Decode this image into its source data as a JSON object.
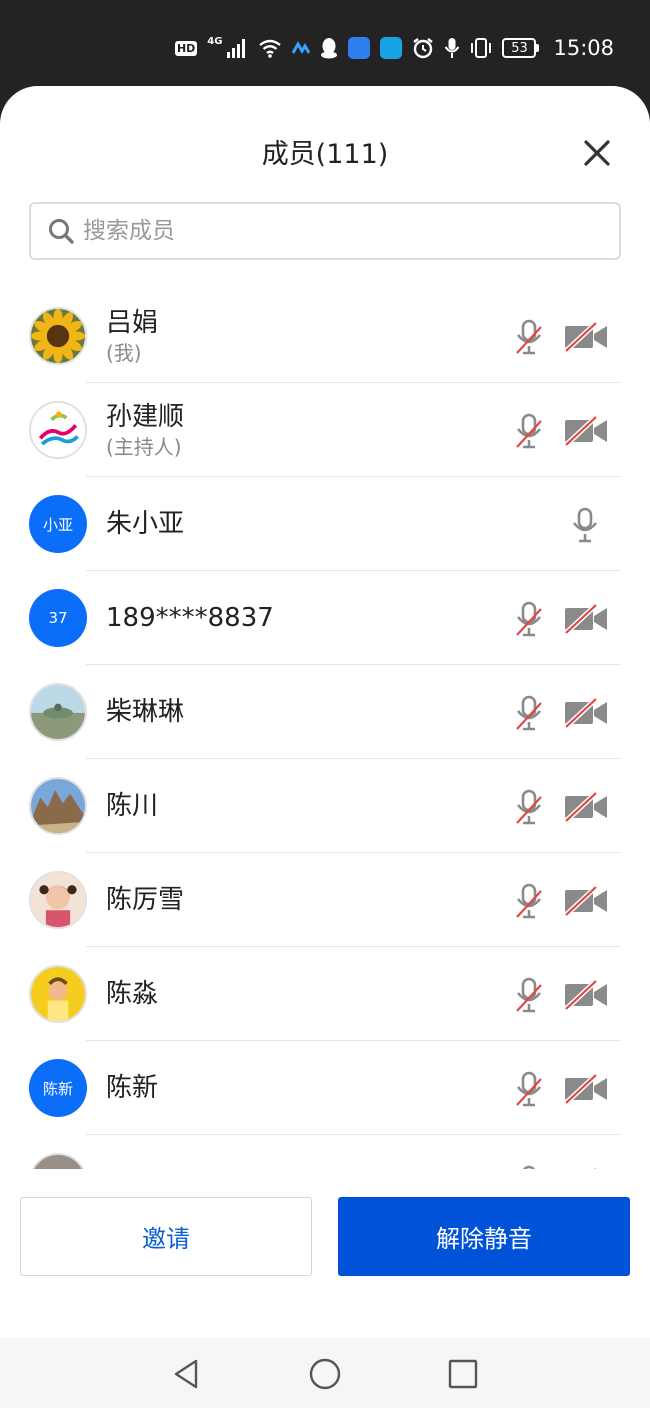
{
  "status_bar": {
    "hd": "HD",
    "network": "4G",
    "battery": "53",
    "time": "15:08"
  },
  "sheet": {
    "title": "成员(111)"
  },
  "search": {
    "placeholder": "搜索成员"
  },
  "members": [
    {
      "name": "吕娟",
      "role": "(我)",
      "avatar_type": "photo",
      "avatar_desc": "sunflower",
      "mic": "muted",
      "camera": "off"
    },
    {
      "name": "孙建顺",
      "role": "(主持人)",
      "avatar_type": "photo",
      "avatar_desc": "colorful-logo",
      "mic": "muted",
      "camera": "off"
    },
    {
      "name": "朱小亚",
      "avatar_type": "text",
      "avatar_text": "小亚",
      "mic": "on",
      "camera": "hidden"
    },
    {
      "name": "189****8837",
      "avatar_type": "text",
      "avatar_text": "37",
      "mic": "muted",
      "camera": "off"
    },
    {
      "name": "柴琳琳",
      "avatar_type": "photo",
      "avatar_desc": "landscape",
      "mic": "muted",
      "camera": "off"
    },
    {
      "name": "陈川",
      "avatar_type": "photo",
      "avatar_desc": "rocks",
      "mic": "muted",
      "camera": "off"
    },
    {
      "name": "陈厉雪",
      "avatar_type": "photo",
      "avatar_desc": "child",
      "mic": "muted",
      "camera": "off"
    },
    {
      "name": "陈淼",
      "avatar_type": "photo",
      "avatar_desc": "yellow",
      "mic": "muted",
      "camera": "off"
    },
    {
      "name": "陈新",
      "avatar_type": "text",
      "avatar_text": "陈新",
      "mic": "muted",
      "camera": "off"
    }
  ],
  "buttons": {
    "invite": "邀请",
    "unmute_all": "解除静音"
  },
  "colors": {
    "primary": "#0052d9",
    "avatar_blue": "#0a6ef8",
    "muted_slash": "#e04848",
    "icon_gray": "#8a8a8a"
  }
}
